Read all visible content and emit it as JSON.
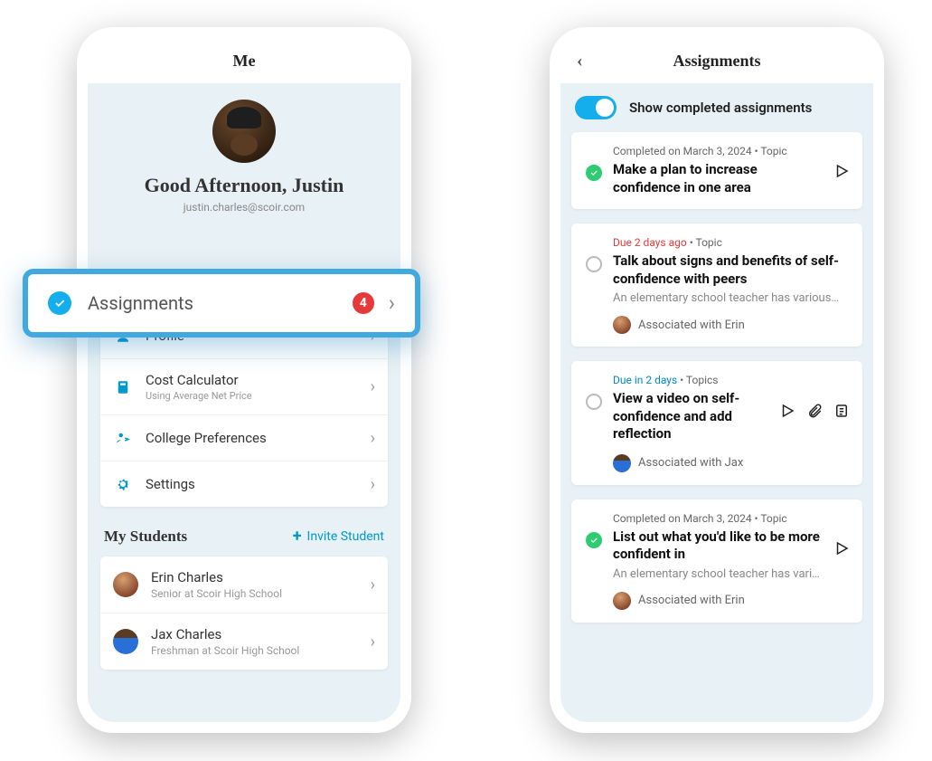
{
  "left": {
    "header_title": "Me",
    "greeting": "Good Afternoon, Justin",
    "email": "justin.charles@scoir.com",
    "highlight": {
      "label": "Assignments",
      "badge": "4"
    },
    "menu": [
      {
        "label": "Profile"
      },
      {
        "label": "Cost Calculator",
        "sub": "Using Average Net Price"
      },
      {
        "label": "College Preferences"
      },
      {
        "label": "Settings"
      }
    ],
    "students_header": "My Students",
    "invite_label": "Invite Student",
    "students": [
      {
        "name": "Erin Charles",
        "sub": "Senior at Scoir High School"
      },
      {
        "name": "Jax Charles",
        "sub": "Freshman at Scoir High School"
      }
    ]
  },
  "right": {
    "header_title": "Assignments",
    "toggle_label": "Show completed assignments",
    "cards": [
      {
        "status": "done",
        "meta_prefix": "Completed on March 3, 2024",
        "meta_suffix": "Topic",
        "title": "Make a plan to increase confidence in one area",
        "actions": [
          "play"
        ]
      },
      {
        "status": "open",
        "due_text": "Due 2 days ago",
        "due_class": "past",
        "meta_suffix": "Topic",
        "title": "Talk about signs and benefits of self-confidence with peers",
        "desc": "An elementary school teacher has various…",
        "assoc": "Associated with Erin",
        "assoc_avatar": "erin",
        "actions": []
      },
      {
        "status": "open",
        "due_text": "Due in 2 days",
        "due_class": "future",
        "meta_suffix": "Topics",
        "title": "View a video on self-confidence and add reflection",
        "assoc": "Associated with Jax",
        "assoc_avatar": "jax",
        "actions": [
          "play",
          "attach",
          "note"
        ]
      },
      {
        "status": "done",
        "meta_prefix": "Completed on March 3, 2024",
        "meta_suffix": "Topic",
        "title": "List out what you'd like to be more confident in",
        "desc": "An elementary school teacher has vari…",
        "assoc": "Associated with Erin",
        "assoc_avatar": "erin",
        "actions": [
          "play"
        ]
      }
    ]
  }
}
